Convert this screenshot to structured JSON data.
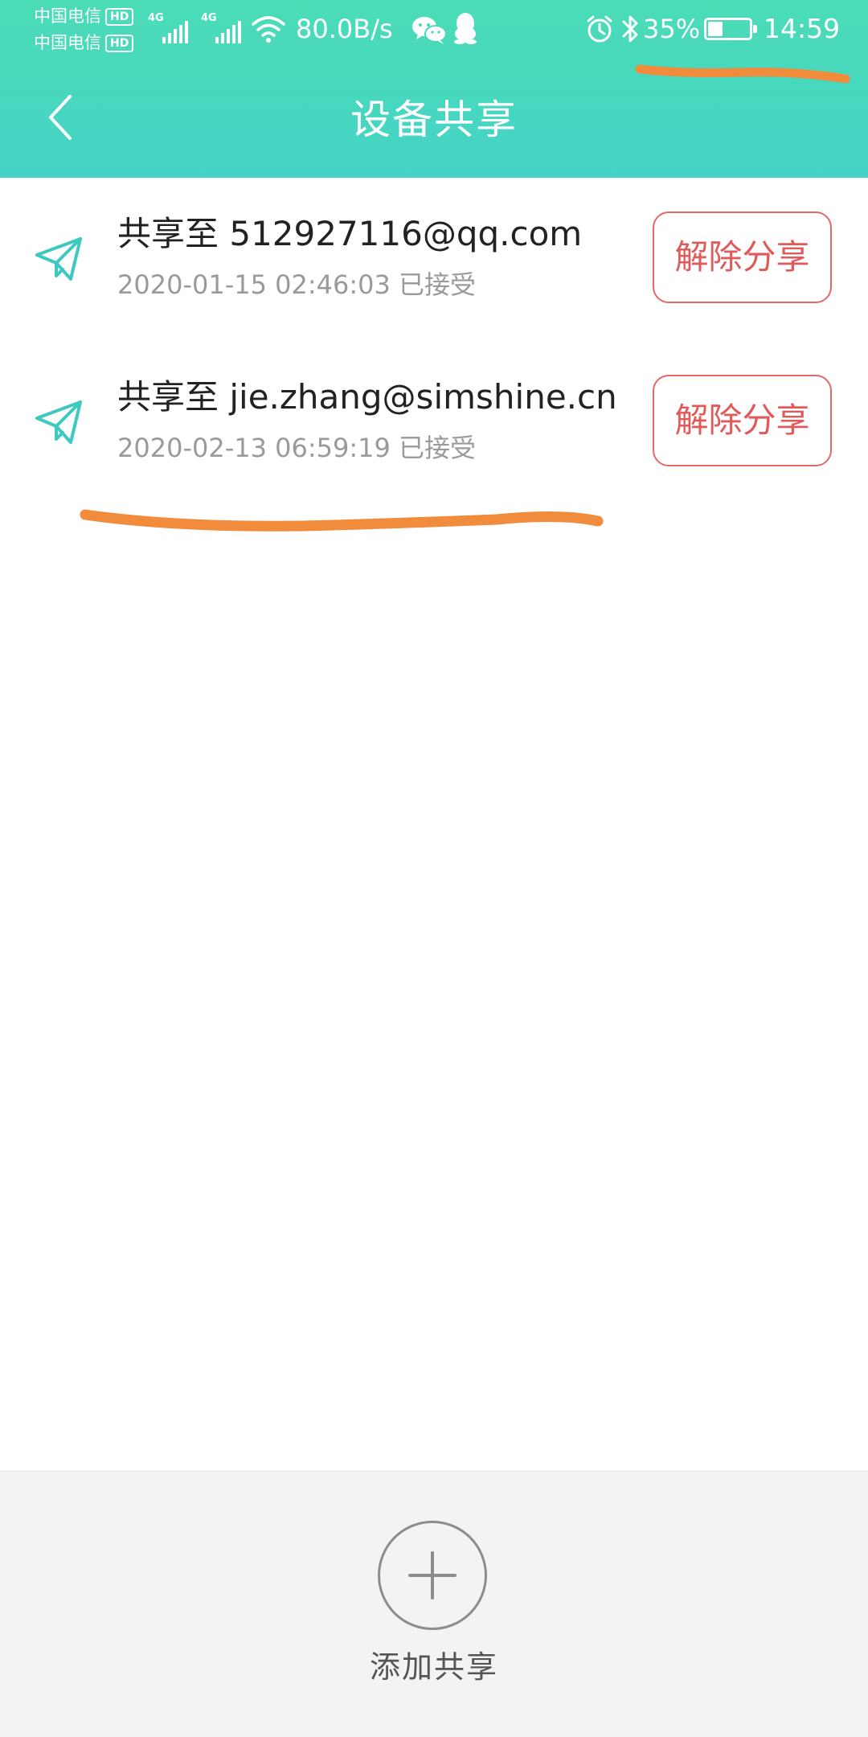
{
  "status_bar": {
    "carrier_1": "中国电信",
    "carrier_2": "中国电信",
    "hd_label": "HD",
    "network_tag_1": "4G",
    "network_tag_2": "4G",
    "net_speed": "80.0B/s",
    "battery_percent": "35%",
    "battery_level": 0.35,
    "time": "14:59"
  },
  "header": {
    "title": "设备共享"
  },
  "shares": [
    {
      "target": "共享至 512927116@qq.com",
      "timestamp": "2020-01-15 02:46:03 已接受",
      "action_label": "解除分享"
    },
    {
      "target": "共享至 jie.zhang@simshine.cn",
      "timestamp": "2020-02-13 06:59:19 已接受",
      "action_label": "解除分享"
    }
  ],
  "bottom": {
    "add_label": "添加共享"
  },
  "colors": {
    "header_top": "#4bdcb6",
    "header_bottom": "#45d3c6",
    "icon_teal": "#3ec9c0",
    "danger": "#e05a5a",
    "annotation": "#f08c3c"
  },
  "icons": {
    "back": "chevron-left-icon",
    "share": "paper-plane-icon",
    "add": "plus-icon"
  }
}
